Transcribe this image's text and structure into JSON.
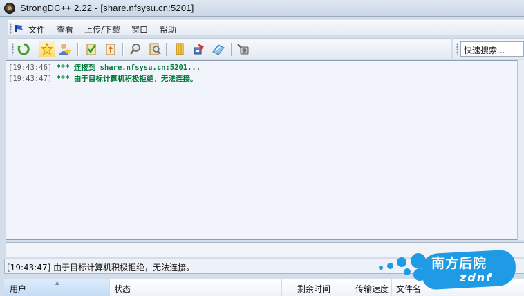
{
  "window": {
    "title": "StrongDC++ 2.22 - [share.nfsysu.cn:5201]"
  },
  "menu": {
    "items": [
      "文件",
      "查看",
      "上传/下载",
      "窗口",
      "帮助"
    ]
  },
  "toolbar": {
    "buttons": [
      {
        "name": "reconnect-icon"
      },
      {
        "name": "favorite-hubs-icon",
        "active": true
      },
      {
        "name": "favorite-users-icon"
      },
      {
        "name": "download-queue-icon"
      },
      {
        "name": "finished-downloads-icon"
      },
      {
        "name": "search-icon"
      },
      {
        "name": "adl-search-icon"
      },
      {
        "name": "notepad-icon"
      },
      {
        "name": "network-stats-icon"
      },
      {
        "name": "open-file-list-icon"
      },
      {
        "name": "settings-icon"
      }
    ],
    "accent": "#ffd96b"
  },
  "quick_search": {
    "value": "快速搜索..."
  },
  "chat": {
    "lines": [
      {
        "time": "[19:43:46]",
        "text": "*** 连接到 share.nfsysu.cn:5201..."
      },
      {
        "time": "[19:43:47]",
        "text": "*** 由于目标计算机积极拒绝，无法连接。"
      }
    ],
    "message_color": "#007a3a"
  },
  "status": {
    "text": "[19:43:47] 由于目标计算机积极拒绝，无法连接。"
  },
  "transfers": {
    "columns": [
      "用户",
      "状态",
      "剩余时间",
      "传输速度",
      "文件名"
    ]
  },
  "watermark": {
    "title": "南方后院",
    "subtitle": "zdnf"
  }
}
